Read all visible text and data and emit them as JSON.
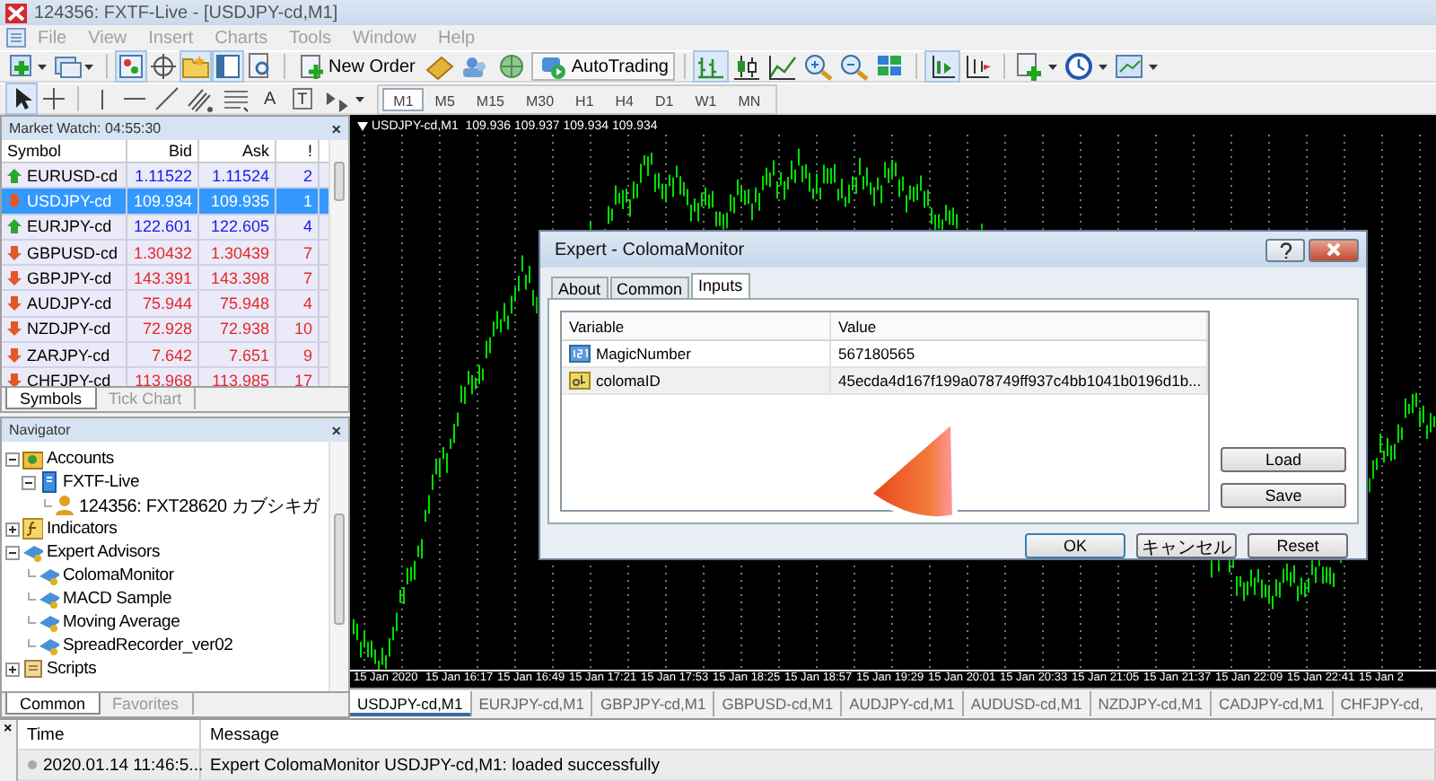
{
  "window": {
    "title": "124356: FXTF-Live - [USDJPY-cd,M1]"
  },
  "menu": [
    "File",
    "View",
    "Insert",
    "Charts",
    "Tools",
    "Window",
    "Help"
  ],
  "toolbar": {
    "new_order": "New Order",
    "autotrading": "AutoTrading",
    "text_tool": "A",
    "label_tool": "T"
  },
  "timeframes": [
    {
      "label": "M1",
      "selected": true
    },
    {
      "label": "M5",
      "selected": false
    },
    {
      "label": "M15",
      "selected": false
    },
    {
      "label": "M30",
      "selected": false
    },
    {
      "label": "H1",
      "selected": false
    },
    {
      "label": "H4",
      "selected": false
    },
    {
      "label": "D1",
      "selected": false
    },
    {
      "label": "W1",
      "selected": false
    },
    {
      "label": "MN",
      "selected": false
    }
  ],
  "market_watch": {
    "title": "Market Watch: 04:55:30",
    "close": "×",
    "columns": [
      "Symbol",
      "Bid",
      "Ask",
      "!"
    ],
    "rows": [
      {
        "symbol": "EURUSD-cd",
        "bid": "1.11522",
        "ask": "1.11524",
        "spread": "2",
        "kind": "up",
        "selected": false
      },
      {
        "symbol": "USDJPY-cd",
        "bid": "109.934",
        "ask": "109.935",
        "spread": "1",
        "kind": "down",
        "selected": true
      },
      {
        "symbol": "EURJPY-cd",
        "bid": "122.601",
        "ask": "122.605",
        "spread": "4",
        "kind": "up",
        "selected": false
      },
      {
        "symbol": "GBPUSD-cd",
        "bid": "1.30432",
        "ask": "1.30439",
        "spread": "7",
        "kind": "down",
        "selected": false
      },
      {
        "symbol": "GBPJPY-cd",
        "bid": "143.391",
        "ask": "143.398",
        "spread": "7",
        "kind": "down",
        "selected": false
      },
      {
        "symbol": "AUDJPY-cd",
        "bid": "75.944",
        "ask": "75.948",
        "spread": "4",
        "kind": "down",
        "selected": false
      },
      {
        "symbol": "NZDJPY-cd",
        "bid": "72.928",
        "ask": "72.938",
        "spread": "10",
        "kind": "down",
        "selected": false
      },
      {
        "symbol": "ZARJPY-cd",
        "bid": "7.642",
        "ask": "7.651",
        "spread": "9",
        "kind": "down",
        "selected": false
      },
      {
        "symbol": "CHFJPY-cd",
        "bid": "113.968",
        "ask": "113.985",
        "spread": "17",
        "kind": "down",
        "selected": false
      }
    ],
    "tabs": [
      {
        "label": "Symbols",
        "selected": true
      },
      {
        "label": "Tick Chart",
        "selected": false
      }
    ]
  },
  "navigator": {
    "title": "Navigator",
    "close": "×",
    "tree": [
      {
        "label": "Accounts",
        "kind": "accounts",
        "expanded": true,
        "children": [
          {
            "label": "FXTF-Live",
            "kind": "server",
            "expanded": true,
            "children": [
              {
                "label": "124356: FXT28620 カブシキガ",
                "kind": "user"
              }
            ]
          }
        ]
      },
      {
        "label": "Indicators",
        "kind": "indicators",
        "expanded": false
      },
      {
        "label": "Expert Advisors",
        "kind": "experts",
        "expanded": true,
        "children": [
          {
            "label": "ColomaMonitor",
            "kind": "expert"
          },
          {
            "label": "MACD Sample",
            "kind": "expert"
          },
          {
            "label": "Moving Average",
            "kind": "expert"
          },
          {
            "label": "SpreadRecorder_ver02",
            "kind": "expert"
          }
        ]
      },
      {
        "label": "Scripts",
        "kind": "scripts",
        "expanded": false
      }
    ],
    "tabs": [
      {
        "label": "Common",
        "selected": true
      },
      {
        "label": "Favorites",
        "selected": false
      }
    ]
  },
  "chart": {
    "header": "USDJPY-cd,M1  109.936 109.937 109.934 109.934",
    "time_labels": [
      "15 Jan 2020",
      "15 Jan 16:17",
      "15 Jan 16:49",
      "15 Jan 17:21",
      "15 Jan 17:53",
      "15 Jan 18:25",
      "15 Jan 18:57",
      "15 Jan 19:29",
      "15 Jan 20:01",
      "15 Jan 20:33",
      "15 Jan 21:05",
      "15 Jan 21:37",
      "15 Jan 22:09",
      "15 Jan 22:41",
      "15 Jan 2"
    ],
    "tabs": [
      {
        "label": "USDJPY-cd,M1",
        "selected": true
      },
      {
        "label": "EURJPY-cd,M1",
        "selected": false
      },
      {
        "label": "GBPJPY-cd,M1",
        "selected": false
      },
      {
        "label": "GBPUSD-cd,M1",
        "selected": false
      },
      {
        "label": "AUDJPY-cd,M1",
        "selected": false
      },
      {
        "label": "AUDUSD-cd,M1",
        "selected": false
      },
      {
        "label": "NZDJPY-cd,M1",
        "selected": false
      },
      {
        "label": "CADJPY-cd,M1",
        "selected": false
      },
      {
        "label": "CHFJPY-cd,",
        "selected": false
      }
    ]
  },
  "dialog": {
    "title": "Expert - ColomaMonitor",
    "tabs": [
      {
        "label": "About",
        "selected": false
      },
      {
        "label": "Common",
        "selected": false
      },
      {
        "label": "Inputs",
        "selected": true
      }
    ],
    "columns": [
      "Variable",
      "Value"
    ],
    "inputs": [
      {
        "kind": "int",
        "variable": "MagicNumber",
        "value": "567180565",
        "selected": false
      },
      {
        "kind": "string",
        "variable": "colomaID",
        "value": "45ecda4d167f199a078749ff937c4bb1041b0196d1b...",
        "selected": true
      }
    ],
    "side_buttons": [
      "Load",
      "Save"
    ],
    "buttons": [
      "OK",
      "キャンセル",
      "Reset"
    ]
  },
  "terminal": {
    "close": "×",
    "columns": [
      "Time",
      "Message"
    ],
    "rows": [
      {
        "time": "2020.01.14 11:46:5...",
        "message": "Expert ColomaMonitor USDJPY-cd,M1: loaded successfully"
      }
    ]
  }
}
